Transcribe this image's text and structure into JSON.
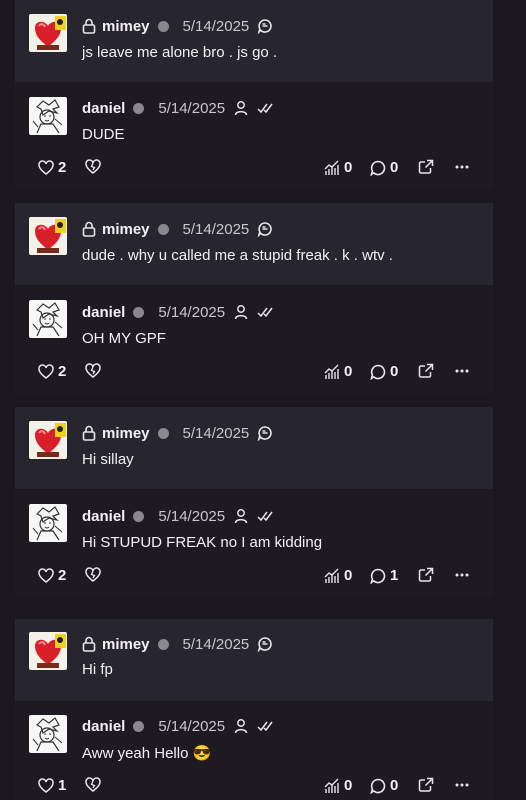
{
  "threads": [
    {
      "post": {
        "author": "mimey",
        "date": "5/14/2025",
        "text": "js leave me alone bro . js go ."
      },
      "reply": {
        "author": "daniel",
        "date": "5/14/2025",
        "text": "DUDE"
      },
      "stats": {
        "likes": "2",
        "views": "0",
        "comments": "0"
      }
    },
    {
      "post": {
        "author": "mimey",
        "date": "5/14/2025",
        "text": "dude . why u called me a stupid freak . k . wtv ."
      },
      "reply": {
        "author": "daniel",
        "date": "5/14/2025",
        "text": "OH MY GPF"
      },
      "stats": {
        "likes": "2",
        "views": "0",
        "comments": "0"
      }
    },
    {
      "post": {
        "author": "mimey",
        "date": "5/14/2025",
        "text": "Hi sillay"
      },
      "reply": {
        "author": "daniel",
        "date": "5/14/2025",
        "text": "Hi STUPUD FREAK no I am kidding"
      },
      "stats": {
        "likes": "2",
        "views": "0",
        "comments": "1"
      }
    },
    {
      "post": {
        "author": "mimey",
        "date": "5/14/2025",
        "text": "Hi fp"
      },
      "reply": {
        "author": "daniel",
        "date": "5/14/2025",
        "text": "Aww yeah Hello 😎"
      },
      "stats": {
        "likes": "1",
        "views": "0",
        "comments": "0"
      }
    }
  ],
  "icons": {
    "lock": "lock-icon",
    "status_dot": "status-dot",
    "chat_bubble": "chat-bubble-icon",
    "person": "person-icon",
    "double_check": "double-check-icon",
    "heart": "heart-icon",
    "broken_heart": "broken-heart-icon",
    "views": "bar-chart-icon",
    "comments": "comment-icon",
    "share": "share-icon",
    "more": "more-icon"
  },
  "colors": {
    "background": "#1a181e",
    "post_header": "#27252d",
    "reply_bg": "#1d1b21",
    "status_dot": "#8a878e",
    "text": "#f2f0f4"
  }
}
